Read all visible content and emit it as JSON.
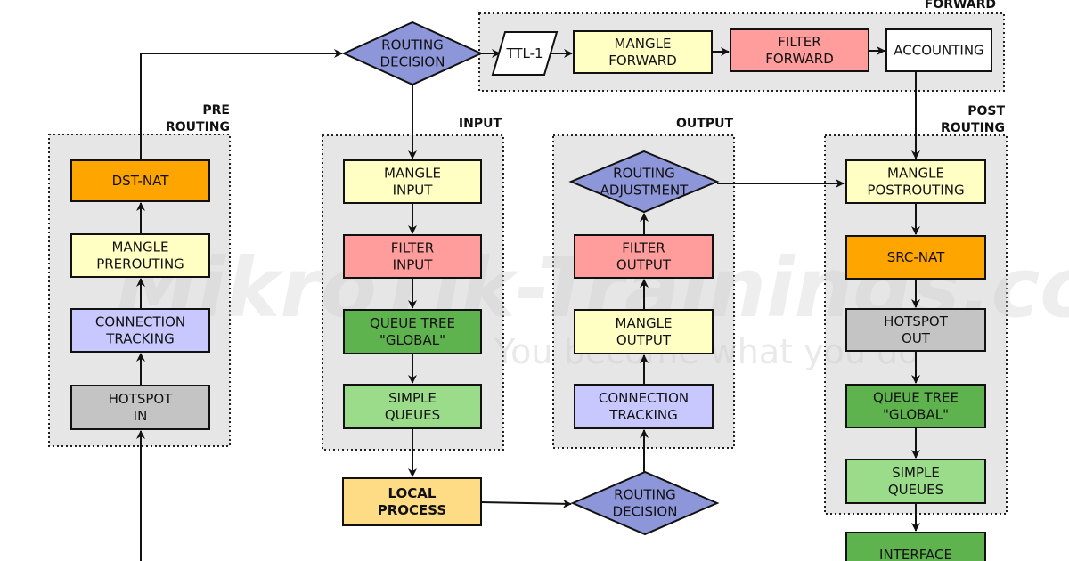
{
  "groups": {
    "forward": "FORWARD",
    "prerouting": [
      "PRE",
      "ROUTING"
    ],
    "input": "INPUT",
    "output": "OUTPUT",
    "postrouting": [
      "POST",
      "ROUTING"
    ]
  },
  "nodes": {
    "routing_decision_top": [
      "ROUTING",
      "DECISION"
    ],
    "ttl": [
      "TTL-1"
    ],
    "mangle_forward": [
      "MANGLE",
      "FORWARD"
    ],
    "filter_forward": [
      "FILTER",
      "FORWARD"
    ],
    "accounting": [
      "ACCOUNTING"
    ],
    "dst_nat": [
      "DST-NAT"
    ],
    "mangle_prerouting": [
      "MANGLE",
      "PREROUTING"
    ],
    "conn_tracking_pre": [
      "CONNECTION",
      "TRACKING"
    ],
    "hotspot_in": [
      "HOTSPOT",
      "IN"
    ],
    "mangle_input": [
      "MANGLE",
      "INPUT"
    ],
    "filter_input": [
      "FILTER",
      "INPUT"
    ],
    "queue_tree_input": [
      "QUEUE TREE",
      "\"GLOBAL\""
    ],
    "simple_queues_input": [
      "SIMPLE",
      "QUEUES"
    ],
    "local_process": [
      "LOCAL",
      "PROCESS"
    ],
    "routing_decision_bottom": [
      "ROUTING",
      "DECISION"
    ],
    "routing_adjustment": [
      "ROUTING",
      "ADJUSTMENT"
    ],
    "filter_output": [
      "FILTER",
      "OUTPUT"
    ],
    "mangle_output": [
      "MANGLE",
      "OUTPUT"
    ],
    "conn_tracking_out": [
      "CONNECTION",
      "TRACKING"
    ],
    "mangle_postrouting": [
      "MANGLE",
      "POSTROUTING"
    ],
    "src_nat": [
      "SRC-NAT"
    ],
    "hotspot_out": [
      "HOTSPOT",
      "OUT"
    ],
    "queue_tree_post": [
      "QUEUE TREE",
      "\"GLOBAL\""
    ],
    "simple_queues_post": [
      "SIMPLE",
      "QUEUES"
    ],
    "interface": [
      "INTERFACE"
    ]
  },
  "watermark": {
    "title": "MikroTik-Trainings.com",
    "tagline": "You become what you do"
  },
  "colors": {
    "mangle": "#ffffc4",
    "filter": "#ff9c9c",
    "nat": "#ffa500",
    "conntrack": "#c8c8ff",
    "hotspot": "#c4c4c4",
    "queue_tree": "#5fb34f",
    "simple_queue": "#9bdc8b",
    "decision": "#8d96d8",
    "local_process": "#fddc85",
    "accounting": "#ffffff"
  }
}
